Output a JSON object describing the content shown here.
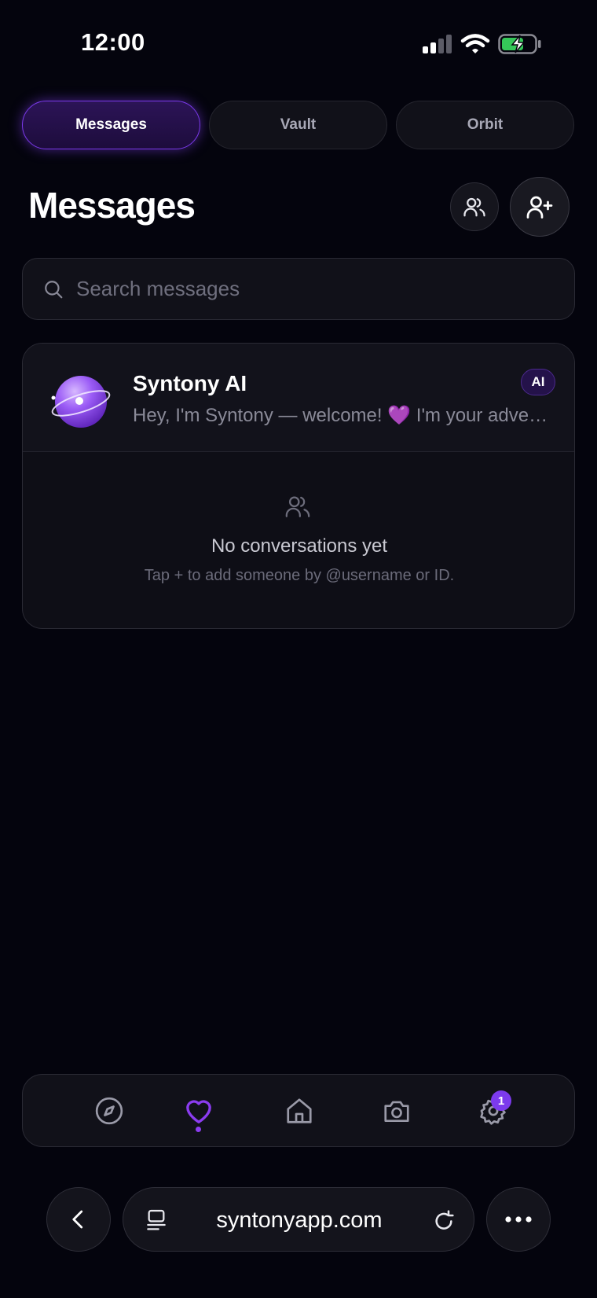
{
  "status_bar": {
    "time": "12:00"
  },
  "tabs": [
    {
      "label": "Messages",
      "active": true
    },
    {
      "label": "Vault",
      "active": false
    },
    {
      "label": "Orbit",
      "active": false
    }
  ],
  "header": {
    "title": "Messages"
  },
  "search": {
    "placeholder": "Search messages",
    "value": ""
  },
  "conversations": [
    {
      "name": "Syntony AI",
      "preview": "Hey, I'm Syntony — welcome! 💜 I'm your adventure guide here at Syntony",
      "badge": "AI"
    }
  ],
  "empty_state": {
    "title": "No conversations yet",
    "subtitle": "Tap + to add someone by @username or ID."
  },
  "bottom_nav": {
    "items": [
      {
        "icon": "compass-icon"
      },
      {
        "icon": "heart-icon",
        "active": true
      },
      {
        "icon": "home-icon"
      },
      {
        "icon": "camera-icon"
      },
      {
        "icon": "gear-icon",
        "badge": "1"
      }
    ]
  },
  "browser": {
    "url": "syntonyapp.com"
  },
  "colors": {
    "background": "#04040d",
    "accent": "#7c3aed",
    "surface": "#111119",
    "muted_text": "#8a8a98"
  }
}
